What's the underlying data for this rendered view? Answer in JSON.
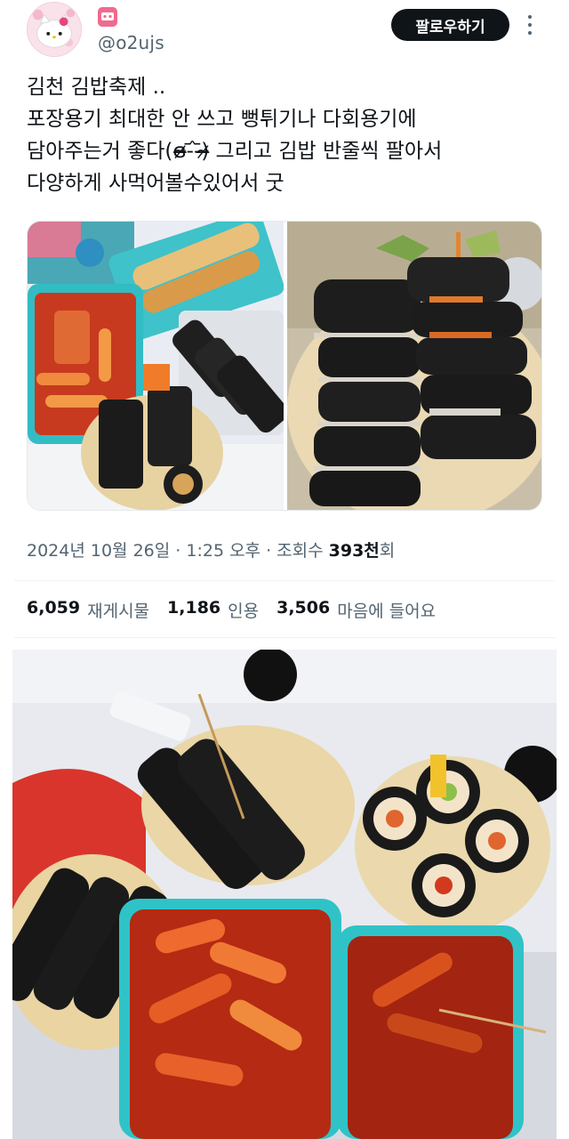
{
  "user": {
    "handle": "@o2ujs",
    "avatar_icon": "hello-kitty-avatar-icon",
    "badge_icon": "pink-face-badge-icon"
  },
  "actions": {
    "follow_label": "팔로우하기",
    "more_icon": "more-options-icon"
  },
  "tweet": {
    "lines": [
      "김천 김밥축제 ..",
      "포장용기 최대한 안 쓰고 뻥튀기나 다회용기에",
      "담아주는거 좋다(ɞ̴̶̷-᷄-᷅)̴̶̷ 그리고 김밥 반줄씩 팔아서",
      "다양하게 사먹어볼수있어서 굿"
    ]
  },
  "media": {
    "photos": [
      {
        "icon": "food-photo-tteokbokki-kimbap"
      },
      {
        "icon": "food-photo-kimbap-stack"
      }
    ]
  },
  "meta": {
    "date": "2024년 10월 26일",
    "sep1": " · ",
    "time": "1:25 오후",
    "sep2": " · ",
    "views_label": "조회수 ",
    "views_value": "393천",
    "views_suffix": "회"
  },
  "stats": {
    "retweets_value": "6,059",
    "retweets_label": "재게시물",
    "quotes_value": "1,186",
    "quotes_label": "인용",
    "likes_value": "3,506",
    "likes_label": "마음에 들어요"
  },
  "colors": {
    "text_primary": "#0f1419",
    "text_secondary": "#536471",
    "button_bg": "#0f1419",
    "divider": "#eff3f4"
  }
}
